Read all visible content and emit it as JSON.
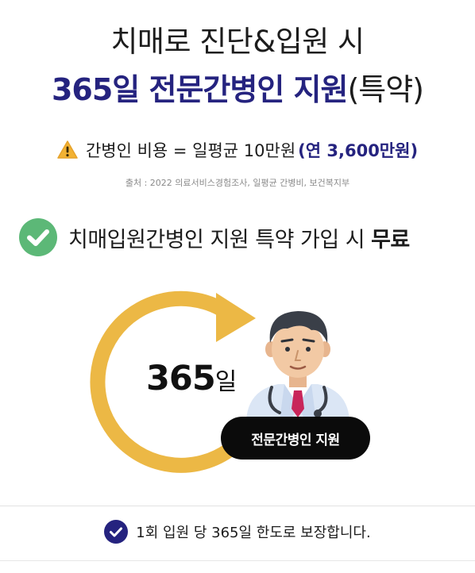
{
  "header": {
    "title_line1": "치매로 진단&입원 시",
    "title_highlight": "365일 전문간병인 지원",
    "title_suffix": "(특약)"
  },
  "cost": {
    "icon": "warning-icon",
    "text": "간병인 비용 = 일평균 10만원",
    "yearly": "(연 3,600만원)",
    "source": "출처 : 2022 의료서비스경험조사, 일평균 간병비, 보건복지부"
  },
  "benefit": {
    "icon": "check-circle-icon",
    "text": "치매입원간병인 지원 특약 가입 시",
    "emphasis": "무료"
  },
  "illustration": {
    "days_number": "365",
    "days_unit": "일",
    "badge_label": "전문간병인 지원",
    "ring_color": "#ecb845",
    "doctor_icon": "doctor-icon"
  },
  "note": {
    "icon": "check-icon",
    "text": "1회 입원 당 365일 한도로 보장합니다."
  },
  "colors": {
    "accent_navy": "#25237f",
    "check_green": "#5cb877",
    "badge_black": "#0b0b0b"
  }
}
